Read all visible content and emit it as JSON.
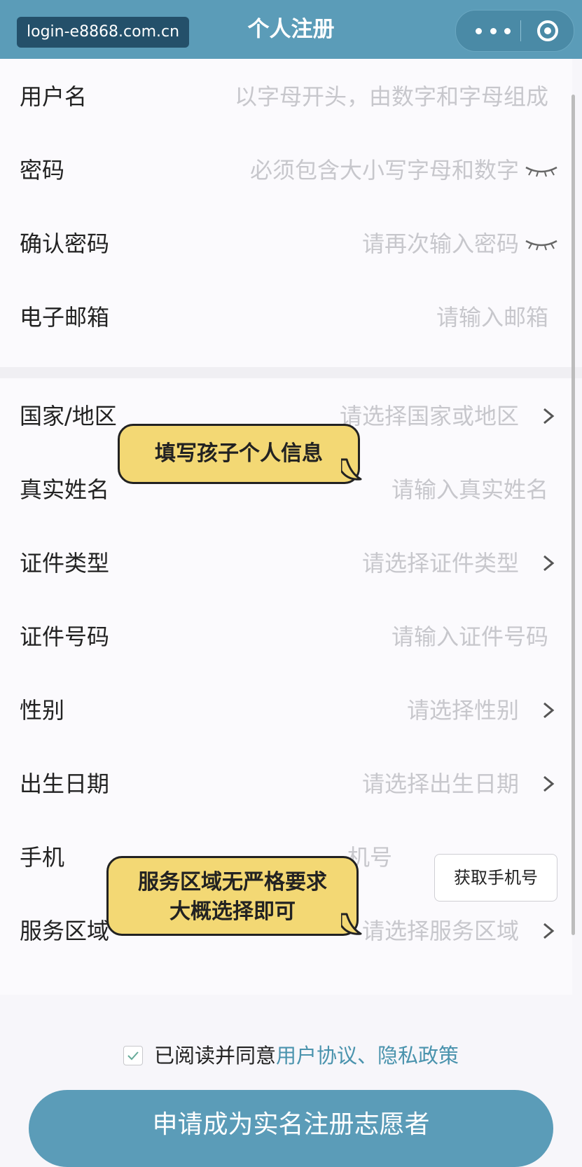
{
  "watermark": "login-e8868.com.cn",
  "header": {
    "title": "个人注册"
  },
  "form": {
    "username": {
      "label": "用户名",
      "placeholder": "以字母开头，由数字和字母组成"
    },
    "password": {
      "label": "密码",
      "placeholder": "必须包含大小写字母和数字"
    },
    "confirm_password": {
      "label": "确认密码",
      "placeholder": "请再次输入密码"
    },
    "email": {
      "label": "电子邮箱",
      "placeholder": "请输入邮箱"
    },
    "country": {
      "label": "国家/地区",
      "placeholder": "请选择国家或地区"
    },
    "real_name": {
      "label": "真实姓名",
      "placeholder": "请输入真实姓名"
    },
    "id_type": {
      "label": "证件类型",
      "placeholder": "请选择证件类型"
    },
    "id_number": {
      "label": "证件号码",
      "placeholder": "请输入证件号码"
    },
    "gender": {
      "label": "性别",
      "placeholder": "请选择性别"
    },
    "birth_date": {
      "label": "出生日期",
      "placeholder": "请选择出生日期"
    },
    "phone": {
      "label": "手机",
      "placeholder_visible": "机号",
      "button": "获取手机号"
    },
    "service_area": {
      "label": "服务区域",
      "placeholder": "请选择服务区域"
    }
  },
  "annotations": {
    "bubble1": "填写孩子个人信息",
    "bubble2_line1": "服务区域无严格要求",
    "bubble2_line2": "大概选择即可"
  },
  "agreement": {
    "checked": true,
    "text": "已阅读并同意",
    "links": "用户协议、隐私政策"
  },
  "submit_label": "申请成为实名注册志愿者",
  "colors": {
    "header": "#5b9cb8",
    "link": "#4a93ad",
    "bubble": "#f3d874",
    "placeholder": "#c7c7cc"
  }
}
